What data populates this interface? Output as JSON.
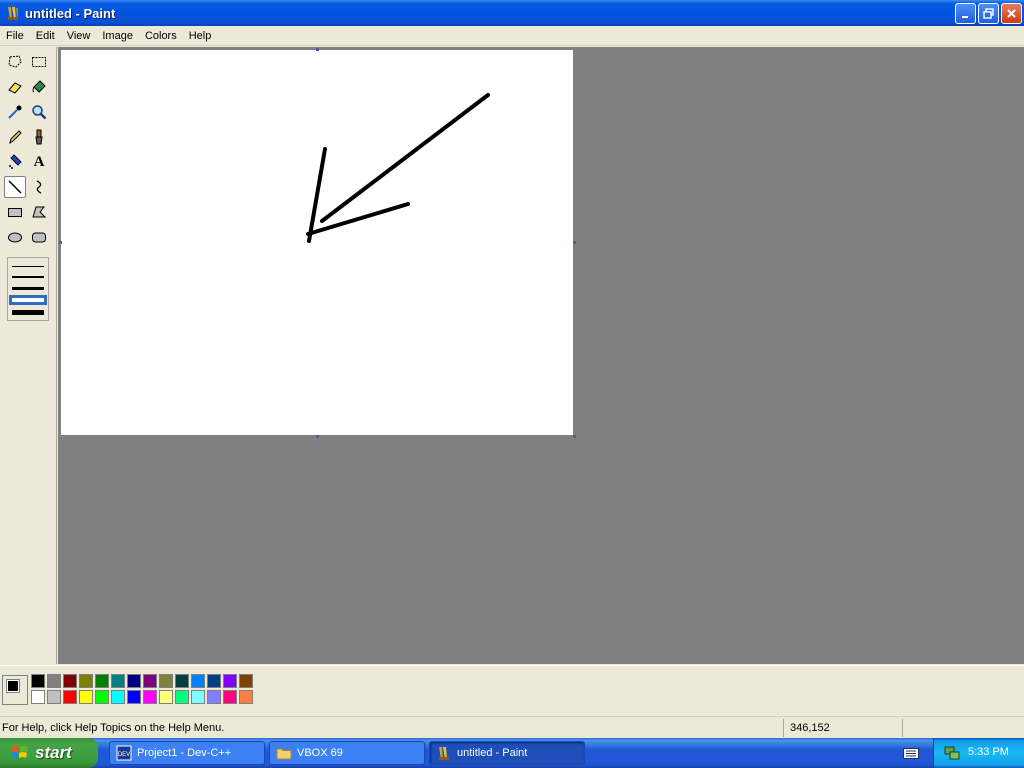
{
  "window": {
    "title": "untitled - Paint",
    "controls": [
      "minimize",
      "restore",
      "close"
    ]
  },
  "menu": [
    "File",
    "Edit",
    "View",
    "Image",
    "Colors",
    "Help"
  ],
  "toolbox": {
    "tools": [
      {
        "name": "free-form-select-icon"
      },
      {
        "name": "select-icon"
      },
      {
        "name": "eraser-icon"
      },
      {
        "name": "fill-with-color-icon"
      },
      {
        "name": "pick-color-icon"
      },
      {
        "name": "magnifier-icon"
      },
      {
        "name": "pencil-icon"
      },
      {
        "name": "brush-icon"
      },
      {
        "name": "airbrush-icon"
      },
      {
        "name": "text-icon",
        "glyph": "A"
      },
      {
        "name": "line-icon",
        "active": true
      },
      {
        "name": "curve-icon"
      },
      {
        "name": "rectangle-icon"
      },
      {
        "name": "polygon-icon"
      },
      {
        "name": "ellipse-icon"
      },
      {
        "name": "rounded-rectangle-icon"
      }
    ],
    "line_widths": [
      "1px",
      "2px",
      "3px",
      "4px",
      "5px"
    ],
    "selected_line_width_index": 3
  },
  "palette": {
    "foreground": "#000000",
    "background": "#ffffff",
    "row1": [
      "#000000",
      "#808080",
      "#800000",
      "#808000",
      "#008000",
      "#008080",
      "#000080",
      "#800080",
      "#808040",
      "#004040",
      "#0080ff",
      "#004080",
      "#8000ff",
      "#804000"
    ],
    "row2": [
      "#ffffff",
      "#c0c0c0",
      "#ff0000",
      "#ffff00",
      "#00ff00",
      "#00ffff",
      "#0000ff",
      "#ff00ff",
      "#ffff80",
      "#00ff80",
      "#80ffff",
      "#8080ff",
      "#ff0080",
      "#ff8040"
    ]
  },
  "status": {
    "help_text": "For Help, click Help Topics on the Help Menu.",
    "coords": "346,152"
  },
  "taskbar": {
    "start_label": "start",
    "tasks": [
      {
        "label": "Project1 - Dev-C++",
        "icon": "devcpp-icon"
      },
      {
        "label": "VBOX 69",
        "icon": "folder-icon"
      },
      {
        "label": "untitled - Paint",
        "icon": "paint-icon",
        "active": true
      }
    ],
    "clock": "5:33 PM"
  }
}
